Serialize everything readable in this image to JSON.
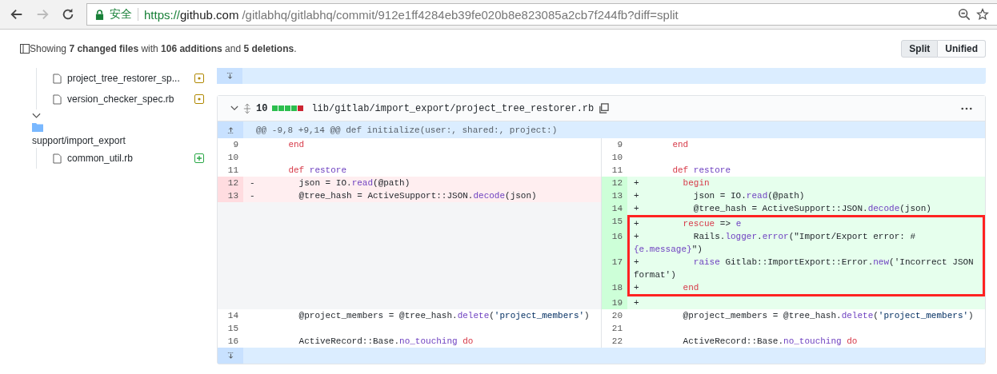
{
  "browser": {
    "back_disabled": false,
    "forward_disabled": true,
    "security_label": "安全",
    "url": {
      "scheme": "https://",
      "host": "github.com",
      "path": "/gitlabhq/gitlabhq/commit/912e1ff4284eb39fe020b8e823085a2cb7f244fb?diff=split"
    }
  },
  "summary": "Showing **7 changed files** with **106 additions** and **5 deletions**.",
  "view_toggle": [
    {
      "label": "Split",
      "selected": true
    },
    {
      "label": "Unified",
      "selected": false
    }
  ],
  "file_tree": [
    {
      "kind": "file",
      "name": "project_tree_restorer_sp...",
      "badge": {
        "kind": "modified"
      }
    },
    {
      "kind": "file",
      "name": "version_checker_spec.rb",
      "badge": {
        "kind": "modified"
      }
    },
    {
      "kind": "folder",
      "name": "support/import_export",
      "expanded": true,
      "children": [
        {
          "kind": "file",
          "name": "common_util.rb",
          "badge": {
            "kind": "added"
          }
        }
      ]
    }
  ],
  "file_diff": {
    "expanded": true,
    "changes": "10",
    "diffstat": [
      {
        "kind": "add"
      },
      {
        "kind": "add"
      },
      {
        "kind": "add"
      },
      {
        "kind": "add"
      },
      {
        "kind": "del"
      }
    ],
    "path": "lib/gitlab/import_export/project_tree_restorer.rb",
    "hunk_header": "@@ -9,8 +9,14 @@ def initialize(user:, shared:, project:)",
    "rows": [
      {
        "boxed": false,
        "left": {
          "num": "9",
          "kind": "context",
          "code": [
            {
              "kind": "keyword",
              "text": "    end"
            }
          ]
        },
        "right": {
          "num": "9",
          "kind": "context",
          "code": [
            {
              "kind": "keyword",
              "text": "    end"
            }
          ]
        }
      },
      {
        "boxed": false,
        "left": {
          "num": "10",
          "kind": "context"
        },
        "right": {
          "num": "10",
          "kind": "context"
        }
      },
      {
        "boxed": false,
        "left": {
          "num": "11",
          "kind": "context",
          "code": [
            {
              "kind": "keyword",
              "text": "    def"
            },
            {
              "kind": "name",
              "text": " restore"
            }
          ]
        },
        "right": {
          "num": "11",
          "kind": "context",
          "code": [
            {
              "kind": "keyword",
              "text": "    def"
            },
            {
              "kind": "name",
              "text": " restore"
            }
          ]
        }
      },
      {
        "boxed": false,
        "left": {
          "num": "12",
          "kind": "del",
          "marker": "-",
          "code": [
            {
              "kind": "plain",
              "text": "      json = IO."
            },
            {
              "kind": "name",
              "text": "read"
            },
            {
              "kind": "plain",
              "text": "(@path)"
            }
          ]
        },
        "right": {
          "num": "12",
          "kind": "add",
          "marker": "+",
          "code": [
            {
              "kind": "keyword",
              "text": "      begin"
            }
          ]
        }
      },
      {
        "boxed": false,
        "left": {
          "num": "13",
          "kind": "del",
          "marker": "-",
          "code": [
            {
              "kind": "plain",
              "text": "      @tree_hash = ActiveSupport::JSON."
            },
            {
              "kind": "name",
              "text": "decode"
            },
            {
              "kind": "plain",
              "text": "(json)"
            }
          ]
        },
        "right": {
          "num": "13",
          "kind": "add",
          "marker": "+",
          "code": [
            {
              "kind": "plain",
              "text": "        json = IO."
            },
            {
              "kind": "name",
              "text": "read"
            },
            {
              "kind": "plain",
              "text": "(@path)"
            }
          ]
        }
      },
      {
        "boxed": false,
        "right": {
          "num": "14",
          "kind": "add",
          "marker": "+",
          "code": [
            {
              "kind": "plain",
              "text": "        @tree_hash = ActiveSupport::JSON."
            },
            {
              "kind": "name",
              "text": "decode"
            },
            {
              "kind": "plain",
              "text": "(json)"
            }
          ]
        }
      },
      {
        "boxed": true,
        "right": {
          "num": "15",
          "kind": "add",
          "marker": "+",
          "code": [
            {
              "kind": "keyword",
              "text": "      rescue"
            },
            {
              "kind": "plain",
              "text": " => "
            },
            {
              "kind": "name",
              "text": "e"
            }
          ]
        }
      },
      {
        "boxed": true,
        "right": {
          "num": "16",
          "kind": "add",
          "marker": "+",
          "code": [
            {
              "kind": "plain",
              "text": "        Rails."
            },
            {
              "kind": "name",
              "text": "logger"
            },
            {
              "kind": "plain",
              "text": "."
            },
            {
              "kind": "name",
              "text": "error"
            },
            {
              "kind": "plain",
              "text": "(\"Import/Export error: #"
            },
            {
              "kind": "name",
              "text": "{e.message}"
            },
            {
              "kind": "plain",
              "text": "\")"
            }
          ]
        }
      },
      {
        "boxed": true,
        "right": {
          "num": "17",
          "kind": "add",
          "marker": "+",
          "code": [
            {
              "kind": "name",
              "text": "        raise"
            },
            {
              "kind": "plain",
              "text": " Gitlab::ImportExport::Error."
            },
            {
              "kind": "name",
              "text": "new"
            },
            {
              "kind": "plain",
              "text": "('Incorrect JSON format')"
            }
          ]
        }
      },
      {
        "boxed": true,
        "right": {
          "num": "18",
          "kind": "add",
          "marker": "+",
          "code": [
            {
              "kind": "keyword",
              "text": "      end"
            }
          ]
        }
      },
      {
        "boxed": false,
        "right": {
          "num": "19",
          "kind": "add",
          "marker": "+"
        }
      },
      {
        "boxed": false,
        "left": {
          "num": "14",
          "kind": "context",
          "code": [
            {
              "kind": "plain",
              "text": "      @project_members = @tree_hash."
            },
            {
              "kind": "name",
              "text": "delete"
            },
            {
              "kind": "plain",
              "text": "("
            },
            {
              "kind": "string",
              "text": "'project_members'"
            },
            {
              "kind": "plain",
              "text": ")"
            }
          ]
        },
        "right": {
          "num": "20",
          "kind": "context",
          "code": [
            {
              "kind": "plain",
              "text": "      @project_members = @tree_hash."
            },
            {
              "kind": "name",
              "text": "delete"
            },
            {
              "kind": "plain",
              "text": "("
            },
            {
              "kind": "string",
              "text": "'project_members'"
            },
            {
              "kind": "plain",
              "text": ")"
            }
          ]
        }
      },
      {
        "boxed": false,
        "left": {
          "num": "15",
          "kind": "context"
        },
        "right": {
          "num": "21",
          "kind": "context"
        }
      },
      {
        "boxed": false,
        "left": {
          "num": "16",
          "kind": "context",
          "code": [
            {
              "kind": "plain",
              "text": "      ActiveRecord::Base."
            },
            {
              "kind": "name",
              "text": "no_touching"
            },
            {
              "kind": "keyword",
              "text": " do"
            }
          ]
        },
        "right": {
          "num": "22",
          "kind": "context",
          "code": [
            {
              "kind": "plain",
              "text": "      ActiveRecord::Base."
            },
            {
              "kind": "name",
              "text": "no_touching"
            },
            {
              "kind": "keyword",
              "text": " do"
            }
          ]
        }
      }
    ]
  }
}
